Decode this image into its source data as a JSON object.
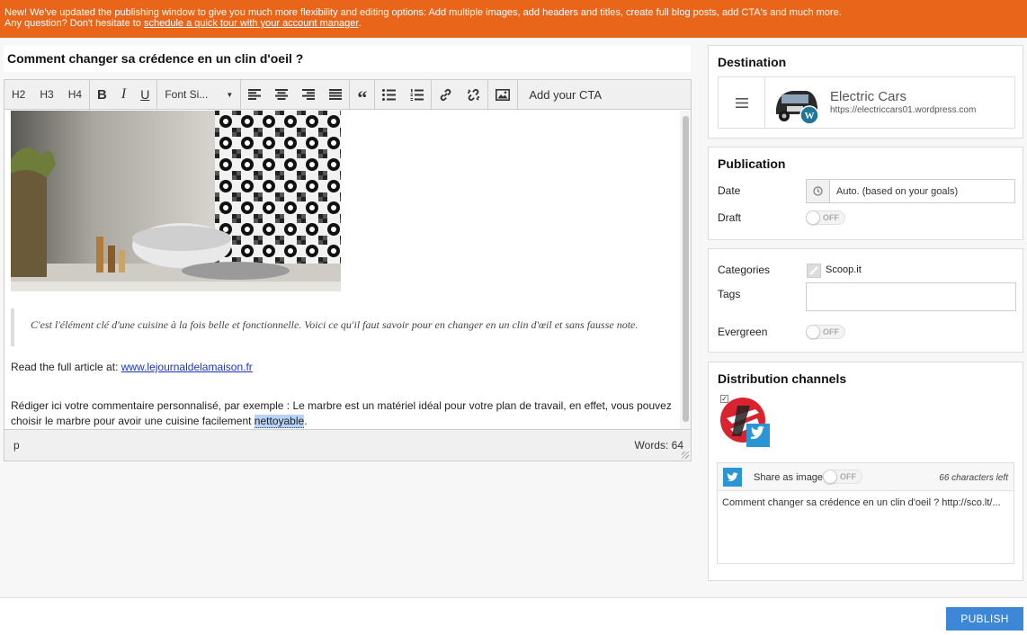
{
  "banner": {
    "line1": "New! We've updated the publishing window to give you much more flexibility and editing options: Add multiple images, add headers and titles, create full blog posts, add CTA's and much more.",
    "line2_prefix": "Any question? Don't hesitate to ",
    "line2_link": "schedule a quick tour with your account manager",
    "line2_suffix": "."
  },
  "editor": {
    "title": "Comment changer sa crédence en un clin d'oeil ?",
    "toolbar": {
      "h2": "H2",
      "h3": "H3",
      "h4": "H4",
      "bold": "B",
      "italic": "I",
      "underline": "U",
      "font_size": "Font Si...",
      "cta": "Add your CTA"
    },
    "quote": "C'est l'élément clé d'une cuisine à la fois belle et fonctionnelle. Voici ce qu'il faut savoir pour en changer en un clin d'œil et sans fausse note.",
    "read_more_prefix": "Read the full article at: ",
    "read_more_link": "www.lejournaldelamaison.fr",
    "comment_before": "Rédiger ici votre commentaire personnalisé, par exemple : Le marbre est un matériel idéal pour votre plan de travail, en effet, vous pouvez choisir le marbre pour avoir une cuisine facilement ",
    "comment_highlight": "nettoyable",
    "comment_after": ".",
    "status_element": "p",
    "word_count": "Words: 64"
  },
  "destination": {
    "title": "Destination",
    "name": "Electric Cars",
    "url": "https://electriccars01.wordpress.com"
  },
  "publication": {
    "title": "Publication",
    "date_label": "Date",
    "date_value": "Auto. (based on your goals)",
    "draft_label": "Draft",
    "draft_toggle": "OFF"
  },
  "meta": {
    "categories_label": "Categories",
    "category_value": "Scoop.it",
    "tags_label": "Tags",
    "evergreen_label": "Evergreen",
    "evergreen_toggle": "OFF"
  },
  "distribution": {
    "title": "Distribution channels",
    "share_label": "Share as image",
    "share_toggle": "OFF",
    "chars_left": "66 characters left",
    "tweet_text": "Comment changer sa crédence en un clin d'oeil ? http://sco.lt/..."
  },
  "footer": {
    "publish": "PUBLISH"
  },
  "colors": {
    "banner": "#e8651a",
    "publish": "#3d87d8",
    "twitter": "#2b95d6",
    "link": "#1a34c8"
  }
}
